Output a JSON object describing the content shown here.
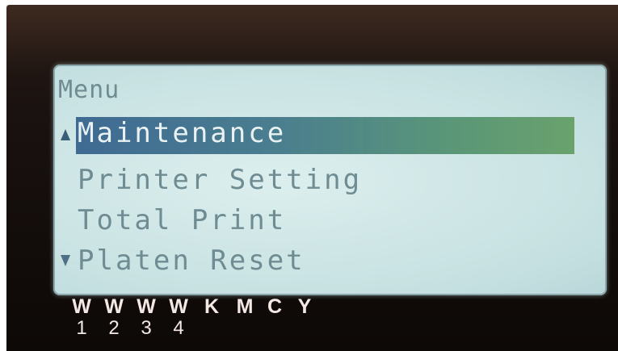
{
  "screen": {
    "title": "Menu",
    "items": [
      {
        "label": "Maintenance",
        "selected": true
      },
      {
        "label": "Printer Setting",
        "selected": false
      },
      {
        "label": "Total Print",
        "selected": false
      },
      {
        "label": "Platen Reset",
        "selected": false
      }
    ],
    "scroll_up_icon": "triangle-up-icon",
    "scroll_down_icon": "triangle-down-icon"
  },
  "ink_slots": [
    {
      "letter": "W",
      "number": "1"
    },
    {
      "letter": "W",
      "number": "2"
    },
    {
      "letter": "W",
      "number": "3"
    },
    {
      "letter": "W",
      "number": "4"
    },
    {
      "letter": "K",
      "number": ""
    },
    {
      "letter": "M",
      "number": ""
    },
    {
      "letter": "C",
      "number": ""
    },
    {
      "letter": "Y",
      "number": ""
    }
  ],
  "colors": {
    "lcd_background": "#cfe6e6",
    "lcd_text": "#6f8c93",
    "highlight_start": "#3f6a93",
    "highlight_end": "#6aa26c",
    "bezel": "#1a1210",
    "ink_label": "#f3e8e4"
  }
}
